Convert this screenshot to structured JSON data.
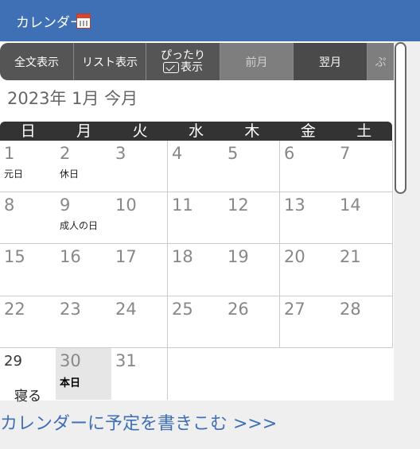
{
  "header": {
    "title": "カレンダー"
  },
  "toolbar": {
    "full_text": "全文表示",
    "list": "リスト表示",
    "fit_top": "ぴったり",
    "fit_bottom": "表示",
    "prev_month": "前月",
    "next_month": "翌月",
    "more": "ぷ"
  },
  "month_label": "2023年 1月 今月",
  "weekdays": [
    "日",
    "月",
    "火",
    "水",
    "木",
    "金",
    "土"
  ],
  "days": [
    {
      "num": "1",
      "event": "元日"
    },
    {
      "num": "2",
      "event": "休日"
    },
    {
      "num": "3",
      "event": ""
    },
    {
      "num": "4",
      "event": ""
    },
    {
      "num": "5",
      "event": ""
    },
    {
      "num": "6",
      "event": ""
    },
    {
      "num": "7",
      "event": ""
    },
    {
      "num": "8",
      "event": ""
    },
    {
      "num": "9",
      "event": "成人の日"
    },
    {
      "num": "10",
      "event": ""
    },
    {
      "num": "11",
      "event": ""
    },
    {
      "num": "12",
      "event": ""
    },
    {
      "num": "13",
      "event": ""
    },
    {
      "num": "14",
      "event": ""
    },
    {
      "num": "15",
      "event": ""
    },
    {
      "num": "16",
      "event": ""
    },
    {
      "num": "17",
      "event": ""
    },
    {
      "num": "18",
      "event": ""
    },
    {
      "num": "19",
      "event": ""
    },
    {
      "num": "20",
      "event": ""
    },
    {
      "num": "21",
      "event": ""
    },
    {
      "num": "22",
      "event": ""
    },
    {
      "num": "23",
      "event": ""
    },
    {
      "num": "24",
      "event": ""
    },
    {
      "num": "25",
      "event": ""
    },
    {
      "num": "26",
      "event": ""
    },
    {
      "num": "27",
      "event": ""
    },
    {
      "num": "28",
      "event": ""
    },
    {
      "num": "29",
      "event": "寝る"
    },
    {
      "num": "30",
      "event": "本日"
    },
    {
      "num": "31",
      "event": ""
    }
  ],
  "footer_link": "カレンダーに予定を書きこむ >>>"
}
